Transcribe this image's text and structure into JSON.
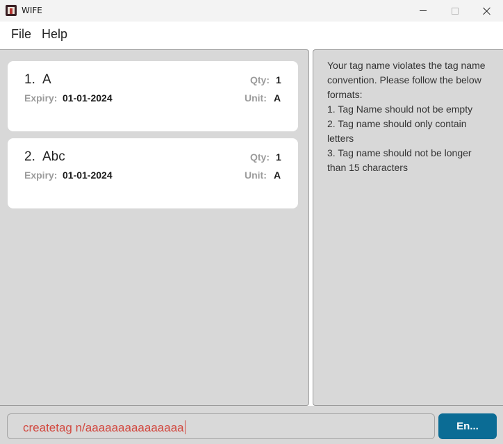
{
  "window": {
    "title": "WIFE",
    "icon": "app-logo-icon",
    "controls": [
      "minimize-icon",
      "maximize-icon",
      "close-icon"
    ]
  },
  "menu": {
    "file": "File",
    "help": "Help"
  },
  "items": [
    {
      "index": "1.",
      "name": "A",
      "qty_label": "Qty:",
      "qty": "1",
      "expiry_label": "Expiry:",
      "expiry": "01-01-2024",
      "unit_label": "Unit:",
      "unit": "A"
    },
    {
      "index": "2.",
      "name": "Abc",
      "qty_label": "Qty:",
      "qty": "1",
      "expiry_label": "Expiry:",
      "expiry": "01-01-2024",
      "unit_label": "Unit:",
      "unit": "A"
    }
  ],
  "result": {
    "lines": [
      "Your tag name violates the tag name",
      "convention. Please follow the below",
      "formats:",
      "1. Tag Name should not be empty",
      "2. Tag name should only contain",
      "letters",
      "3. Tag name should not be longer",
      "than 15 characters"
    ]
  },
  "command": {
    "value": "createtag n/aaaaaaaaaaaaaaa",
    "button_label": "En..."
  },
  "colors": {
    "panel": "#d8d8d8",
    "accent": "#0b6c95",
    "error_text": "#d2483f"
  }
}
